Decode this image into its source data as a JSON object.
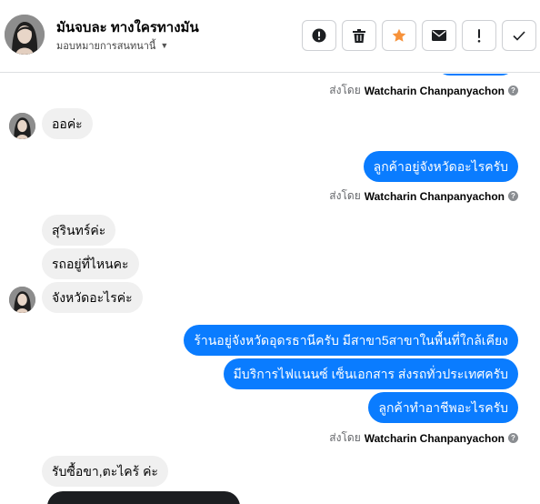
{
  "header": {
    "contact_name": "มันจบละ ทางใครทางมัน",
    "assign_label": "มอบหมายการสนทนานี้"
  },
  "toolbar": {
    "buttons": [
      {
        "name": "alert-button",
        "icon": "alert-circle-icon"
      },
      {
        "name": "delete-button",
        "icon": "trash-icon"
      },
      {
        "name": "star-button",
        "icon": "star-icon",
        "color": "#f7923a"
      },
      {
        "name": "mail-button",
        "icon": "envelope-icon"
      },
      {
        "name": "important-button",
        "icon": "exclamation-icon"
      },
      {
        "name": "done-button",
        "icon": "checkmark-icon"
      }
    ]
  },
  "messages": {
    "sent_by_prefix": "ส่งโดย",
    "sender": "Watcharin Chanpanyachon",
    "m1": "ออค่ะ",
    "m2": "ลูกค้าอยู่จังหวัดอะไรครับ",
    "m3": "สุรินทร์ค่ะ",
    "m4": "รถอยู่ที่ไหนคะ",
    "m5": "จังหวัดอะไรค่ะ",
    "m6": "ร้านอยู่จังหวัดอุดรธานีครับ มีสาขา5สาขาในพื้นที่ใกล้เคียง",
    "m7": "มีบริการไฟแนนซ์ เซ็นเอกสาร ส่งรถทั่วประเทศครับ",
    "m8": "ลูกค้าทำอาชีพอะไรครับ",
    "m9": "รับซื้อขา,ตะไคร้ ค่ะ"
  },
  "colors": {
    "outgoing_bubble": "#0a7cff",
    "incoming_bubble": "#f0f0f0",
    "star": "#f7923a"
  }
}
